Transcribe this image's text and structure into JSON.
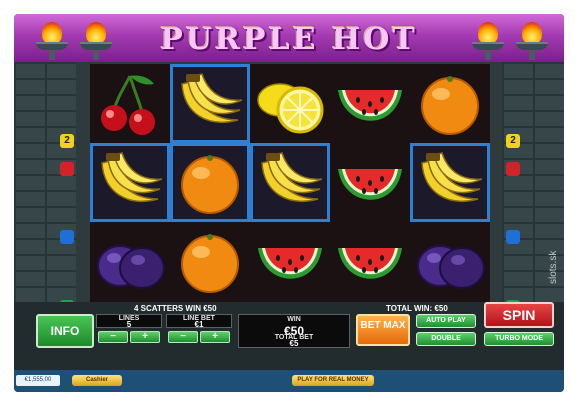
{
  "game": {
    "title": "PURPLE HOT",
    "colors": {
      "header_purple": "#a43ab2",
      "win_highlight": "#2f7fd2",
      "spin_red": "#d0222a",
      "bet_max_orange": "#f28a1e",
      "button_green": "#2aa83a"
    }
  },
  "paylines": {
    "left": [
      {
        "label": "2",
        "color": "yellow"
      },
      {
        "label": "",
        "color": "red"
      },
      {
        "label": "",
        "color": "blue"
      },
      {
        "label": "",
        "color": "green"
      },
      {
        "label": "",
        "color": "purple"
      }
    ],
    "right": [
      {
        "label": "2",
        "color": "yellow"
      },
      {
        "label": "",
        "color": "red"
      },
      {
        "label": "",
        "color": "blue"
      },
      {
        "label": "",
        "color": "green"
      },
      {
        "label": "",
        "color": "purple"
      }
    ]
  },
  "reels": [
    [
      {
        "symbol": "cherries",
        "win": false
      },
      {
        "symbol": "bananas",
        "win": true
      },
      {
        "symbol": "plums",
        "win": false
      }
    ],
    [
      {
        "symbol": "bananas",
        "win": true
      },
      {
        "symbol": "orange",
        "win": true
      },
      {
        "symbol": "orange",
        "win": false
      }
    ],
    [
      {
        "symbol": "lemon",
        "win": false
      },
      {
        "symbol": "bananas",
        "win": true
      },
      {
        "symbol": "watermelon",
        "win": false
      }
    ],
    [
      {
        "symbol": "watermelon",
        "win": false
      },
      {
        "symbol": "watermelon",
        "win": false
      },
      {
        "symbol": "watermelon",
        "win": false
      }
    ],
    [
      {
        "symbol": "orange",
        "win": false
      },
      {
        "symbol": "bananas",
        "win": true
      },
      {
        "symbol": "plums",
        "win": false
      }
    ]
  ],
  "panel": {
    "scatter_message": "4 SCATTERS WIN €50",
    "total_win": "TOTAL WIN: €50",
    "info_label": "INFO",
    "lines": {
      "title": "LINES",
      "value": "5"
    },
    "line_bet": {
      "title": "LINE BET",
      "value": "€1"
    },
    "win": {
      "title": "WIN",
      "value": "€50"
    },
    "total_bet": {
      "title": "TOTAL BET",
      "value": "€5"
    },
    "minus_label": "−",
    "plus_label": "+",
    "bet_max_label": "BET MAX",
    "auto_play_label": "AUTO PLAY",
    "double_label": "DOUBLE",
    "spin_label": "SPIN",
    "turbo_mode_label": "TURBO MODE"
  },
  "footer": {
    "balance": "€1,555.00",
    "cashier_label": "Cashier",
    "real_money_label": "PLAY FOR REAL MONEY"
  },
  "watermark": "slots.sk"
}
